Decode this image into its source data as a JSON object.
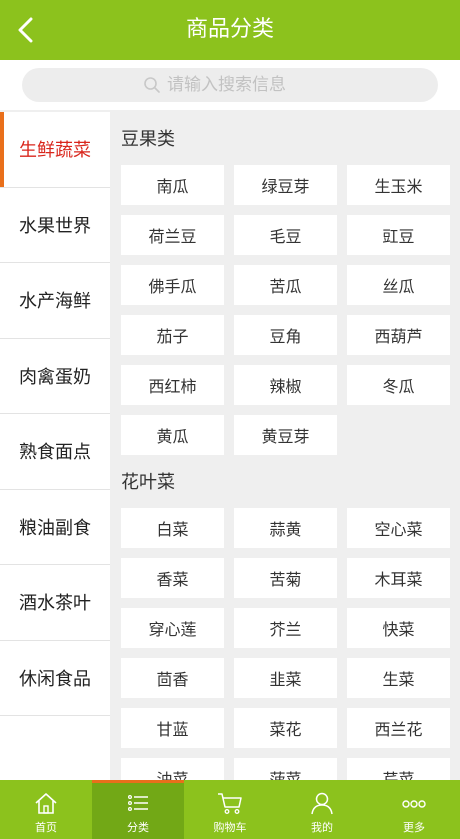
{
  "header": {
    "title": "商品分类",
    "back_icon": "chevron-left-icon"
  },
  "search": {
    "placeholder": "请输入搜索信息",
    "icon": "search-icon"
  },
  "sidebar": {
    "items": [
      {
        "label": "生鲜蔬菜",
        "active": true
      },
      {
        "label": "水果世界",
        "active": false
      },
      {
        "label": "水产海鲜",
        "active": false
      },
      {
        "label": "肉禽蛋奶",
        "active": false
      },
      {
        "label": "熟食面点",
        "active": false
      },
      {
        "label": "粮油副食",
        "active": false
      },
      {
        "label": "酒水茶叶",
        "active": false
      },
      {
        "label": "休闲食品",
        "active": false
      }
    ]
  },
  "groups": [
    {
      "title": "豆果类",
      "items": [
        "南瓜",
        "绿豆芽",
        "生玉米",
        "荷兰豆",
        "毛豆",
        "豇豆",
        "佛手瓜",
        "苦瓜",
        "丝瓜",
        "茄子",
        "豆角",
        "西葫芦",
        "西红柿",
        "辣椒",
        "冬瓜",
        "黄瓜",
        "黄豆芽"
      ]
    },
    {
      "title": "花叶菜",
      "items": [
        "白菜",
        "蒜黄",
        "空心菜",
        "香菜",
        "苦菊",
        "木耳菜",
        "穿心莲",
        "芥兰",
        "快菜",
        "茴香",
        "韭菜",
        "生菜",
        "甘蓝",
        "菜花",
        "西兰花",
        "油菜",
        "菠菜",
        "芹菜"
      ]
    }
  ],
  "tabbar": {
    "tabs": [
      {
        "label": "首页",
        "icon": "home-icon",
        "active": false
      },
      {
        "label": "分类",
        "icon": "list-icon",
        "active": true
      },
      {
        "label": "购物车",
        "icon": "cart-icon",
        "active": false
      },
      {
        "label": "我的",
        "icon": "user-icon",
        "active": false
      },
      {
        "label": "更多",
        "icon": "more-icon",
        "active": false
      }
    ]
  },
  "colors": {
    "brand_green": "#8cc21d",
    "active_red": "#d9261c",
    "active_orange": "#e96f1b"
  }
}
